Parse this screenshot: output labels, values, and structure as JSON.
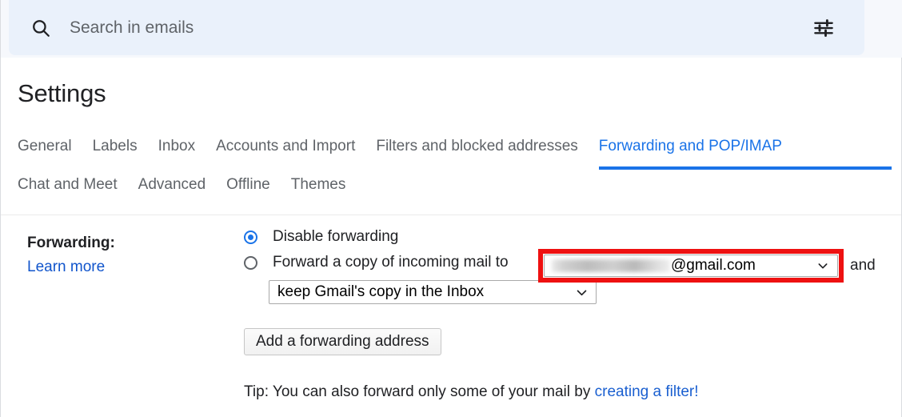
{
  "search": {
    "placeholder": "Search in emails",
    "value": "",
    "search_icon": "search-icon",
    "tune_icon": "tune-filter-icon"
  },
  "page_title": "Settings",
  "tabs": {
    "row1": [
      {
        "label": "General",
        "active": false
      },
      {
        "label": "Labels",
        "active": false
      },
      {
        "label": "Inbox",
        "active": false
      },
      {
        "label": "Accounts and Import",
        "active": false
      },
      {
        "label": "Filters and blocked addresses",
        "active": false
      },
      {
        "label": "Forwarding and POP/IMAP",
        "active": true
      }
    ],
    "row2": [
      {
        "label": "Chat and Meet",
        "active": false
      },
      {
        "label": "Advanced",
        "active": false
      },
      {
        "label": "Offline",
        "active": false
      },
      {
        "label": "Themes",
        "active": false
      }
    ],
    "active_tab": "Forwarding and POP/IMAP",
    "active_color": "#1a73e8"
  },
  "forwarding": {
    "label": "Forwarding:",
    "learn_more": "Learn more",
    "option_disable": "Disable forwarding",
    "option_forward": "Forward a copy of incoming mail to",
    "disable_selected": true,
    "forward_selected": false,
    "address_select": {
      "redacted_username": "",
      "domain": "@gmail.com",
      "chevron": "chevron-down-icon",
      "highlight_color": "#ee1111"
    },
    "and_text": "and",
    "keep_select": {
      "value": "keep Gmail's copy in the Inbox",
      "chevron": "chevron-down-icon"
    },
    "add_button": "Add a forwarding address",
    "tip_prefix": "Tip: You can also forward only some of your mail by ",
    "tip_link": "creating a filter!"
  }
}
